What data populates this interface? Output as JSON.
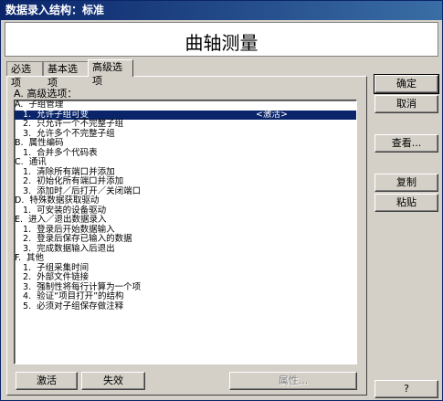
{
  "window": {
    "title": "数据录入结构：标准"
  },
  "header": {
    "title": "曲轴测量"
  },
  "tabs": [
    {
      "label": "必选项"
    },
    {
      "label": "基本选项"
    },
    {
      "label": "高级选项"
    }
  ],
  "options": {
    "label": "A. 高级选项：",
    "rows": [
      {
        "text": "A.  子组管理",
        "right": ""
      },
      {
        "text": "   1.  允许子组可变",
        "right": "<激活>",
        "selected": true
      },
      {
        "text": "   2.  只允许一个不完整子组",
        "right": ""
      },
      {
        "text": "   3.  允许多个不完整子组",
        "right": ""
      },
      {
        "text": "B.  属性编码",
        "right": ""
      },
      {
        "text": "   1.  合并多个代码表",
        "right": ""
      },
      {
        "text": "C.  通讯",
        "right": ""
      },
      {
        "text": "   1.  清除所有端口并添加",
        "right": ""
      },
      {
        "text": "   2.  初始化所有端口并添加",
        "right": ""
      },
      {
        "text": "   3.  添加时／后打开／关闭端口",
        "right": ""
      },
      {
        "text": "D.  特殊数据获取驱动",
        "right": ""
      },
      {
        "text": "   1.  可安装的设备驱动",
        "right": ""
      },
      {
        "text": "E.  进入／退出数据录入",
        "right": ""
      },
      {
        "text": "   1.  登录后开始数据输入",
        "right": ""
      },
      {
        "text": "   2.  登录后保存已输入的数据",
        "right": ""
      },
      {
        "text": "   3.  完成数据输入后退出",
        "right": ""
      },
      {
        "text": "F.  其他",
        "right": ""
      },
      {
        "text": "   1.  子组采集时间",
        "right": ""
      },
      {
        "text": "   2.  外部文件链接",
        "right": ""
      },
      {
        "text": "   3.  强制性将每行计算为一个项",
        "right": ""
      },
      {
        "text": "   4.  验证“项目打开”的结构",
        "right": ""
      },
      {
        "text": "   5.  必须对子组保存做注释",
        "right": ""
      }
    ]
  },
  "buttons": {
    "activate": "激活",
    "deactivate": "失效",
    "properties": "属性...",
    "ok": "确定",
    "cancel": "取消",
    "view": "查看...",
    "copy": "复制",
    "paste": "粘贴",
    "help": "?"
  }
}
